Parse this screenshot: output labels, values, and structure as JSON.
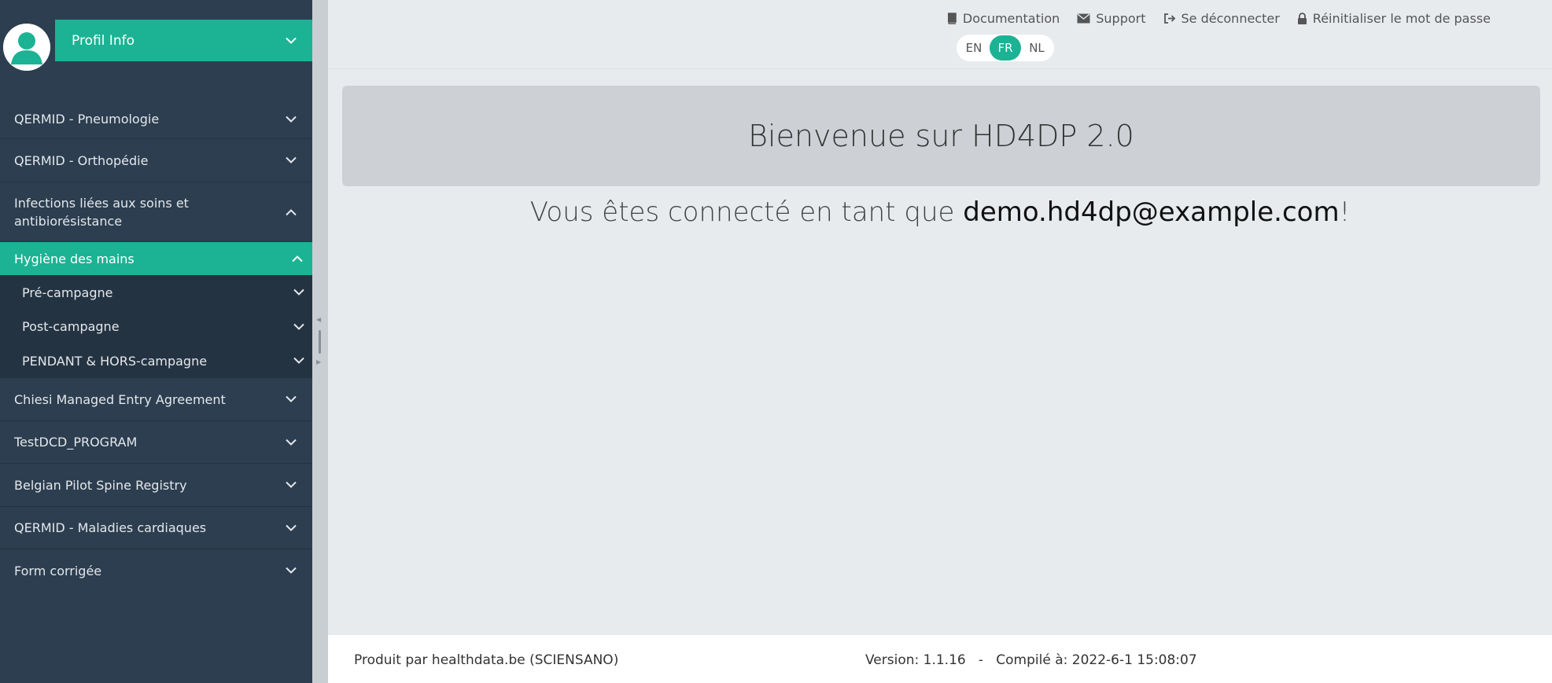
{
  "profile": {
    "label": "Profil Info"
  },
  "nav": [
    {
      "label": "QERMID - Pneumologie"
    },
    {
      "label": "QERMID - Orthopédie"
    },
    {
      "label": "Infections liées aux soins et antibiorésistance"
    },
    {
      "label": "Hygiène des mains"
    },
    {
      "label": "Pré-campagne"
    },
    {
      "label": "Post-campagne"
    },
    {
      "label": "PENDANT & HORS-campagne"
    },
    {
      "label": "Chiesi Managed Entry Agreement"
    },
    {
      "label": "TestDCD_PROGRAM"
    },
    {
      "label": "Belgian Pilot Spine Registry"
    },
    {
      "label": "QERMID - Maladies cardiaques"
    },
    {
      "label": "Form corrigée"
    }
  ],
  "header": {
    "links": [
      {
        "label": "Documentation",
        "icon": "book-icon"
      },
      {
        "label": "Support",
        "icon": "envelope-icon"
      },
      {
        "label": "Se déconnecter",
        "icon": "sign-out-icon"
      },
      {
        "label": "Réinitialiser le mot de passe",
        "icon": "lock-icon"
      }
    ],
    "languages": [
      "EN",
      "FR",
      "NL"
    ],
    "active_language": "FR"
  },
  "main": {
    "welcome": "Bienvenue sur HD4DP 2.0",
    "logged_prefix": "Vous êtes connecté en tant que ",
    "logged_email": "demo.hd4dp@example.com",
    "logged_suffix": "!"
  },
  "footer": {
    "produced_by": "Produit par healthdata.be (SCIENSANO)",
    "version": "Version: 1.1.16   -   Compilé à: 2022-6-1 15:08:07"
  },
  "colors": {
    "accent": "#1bb394",
    "sidebar": "#2c3e50",
    "background": "#e8ebee"
  }
}
